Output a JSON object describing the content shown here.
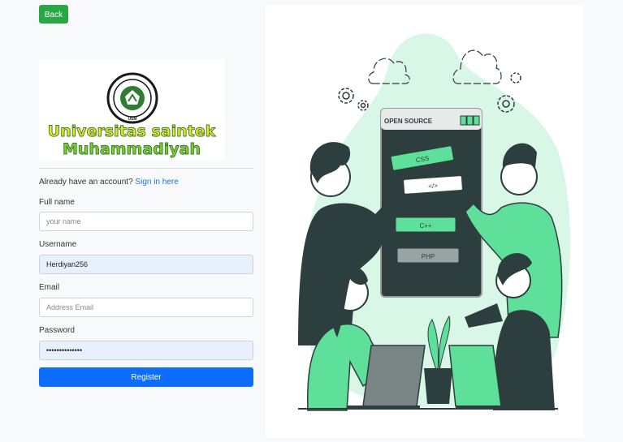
{
  "nav": {
    "back_label": "Back"
  },
  "logo": {
    "line1": "Universitas saintek",
    "line2": "Muhammadiyah",
    "badge": "USM"
  },
  "login_prompt": {
    "text": "Already have an account?",
    "link": "Sign in here"
  },
  "form": {
    "full_name": {
      "label": "Full name",
      "placeholder": "your name",
      "value": ""
    },
    "username": {
      "label": "Username",
      "value": "Herdiyan256"
    },
    "email": {
      "label": "Email",
      "placeholder": "Address Email",
      "value": ""
    },
    "password": {
      "label": "Password",
      "value": "••••••••••••••"
    },
    "submit_label": "Register"
  },
  "illustration": {
    "window_title": "OPEN SOURCE",
    "tags": [
      "CSS",
      "</>",
      "C++",
      "PHP"
    ]
  },
  "colors": {
    "accent_green": "#5ee09a",
    "primary_blue": "#0d6efd",
    "back_green": "#28a745"
  }
}
